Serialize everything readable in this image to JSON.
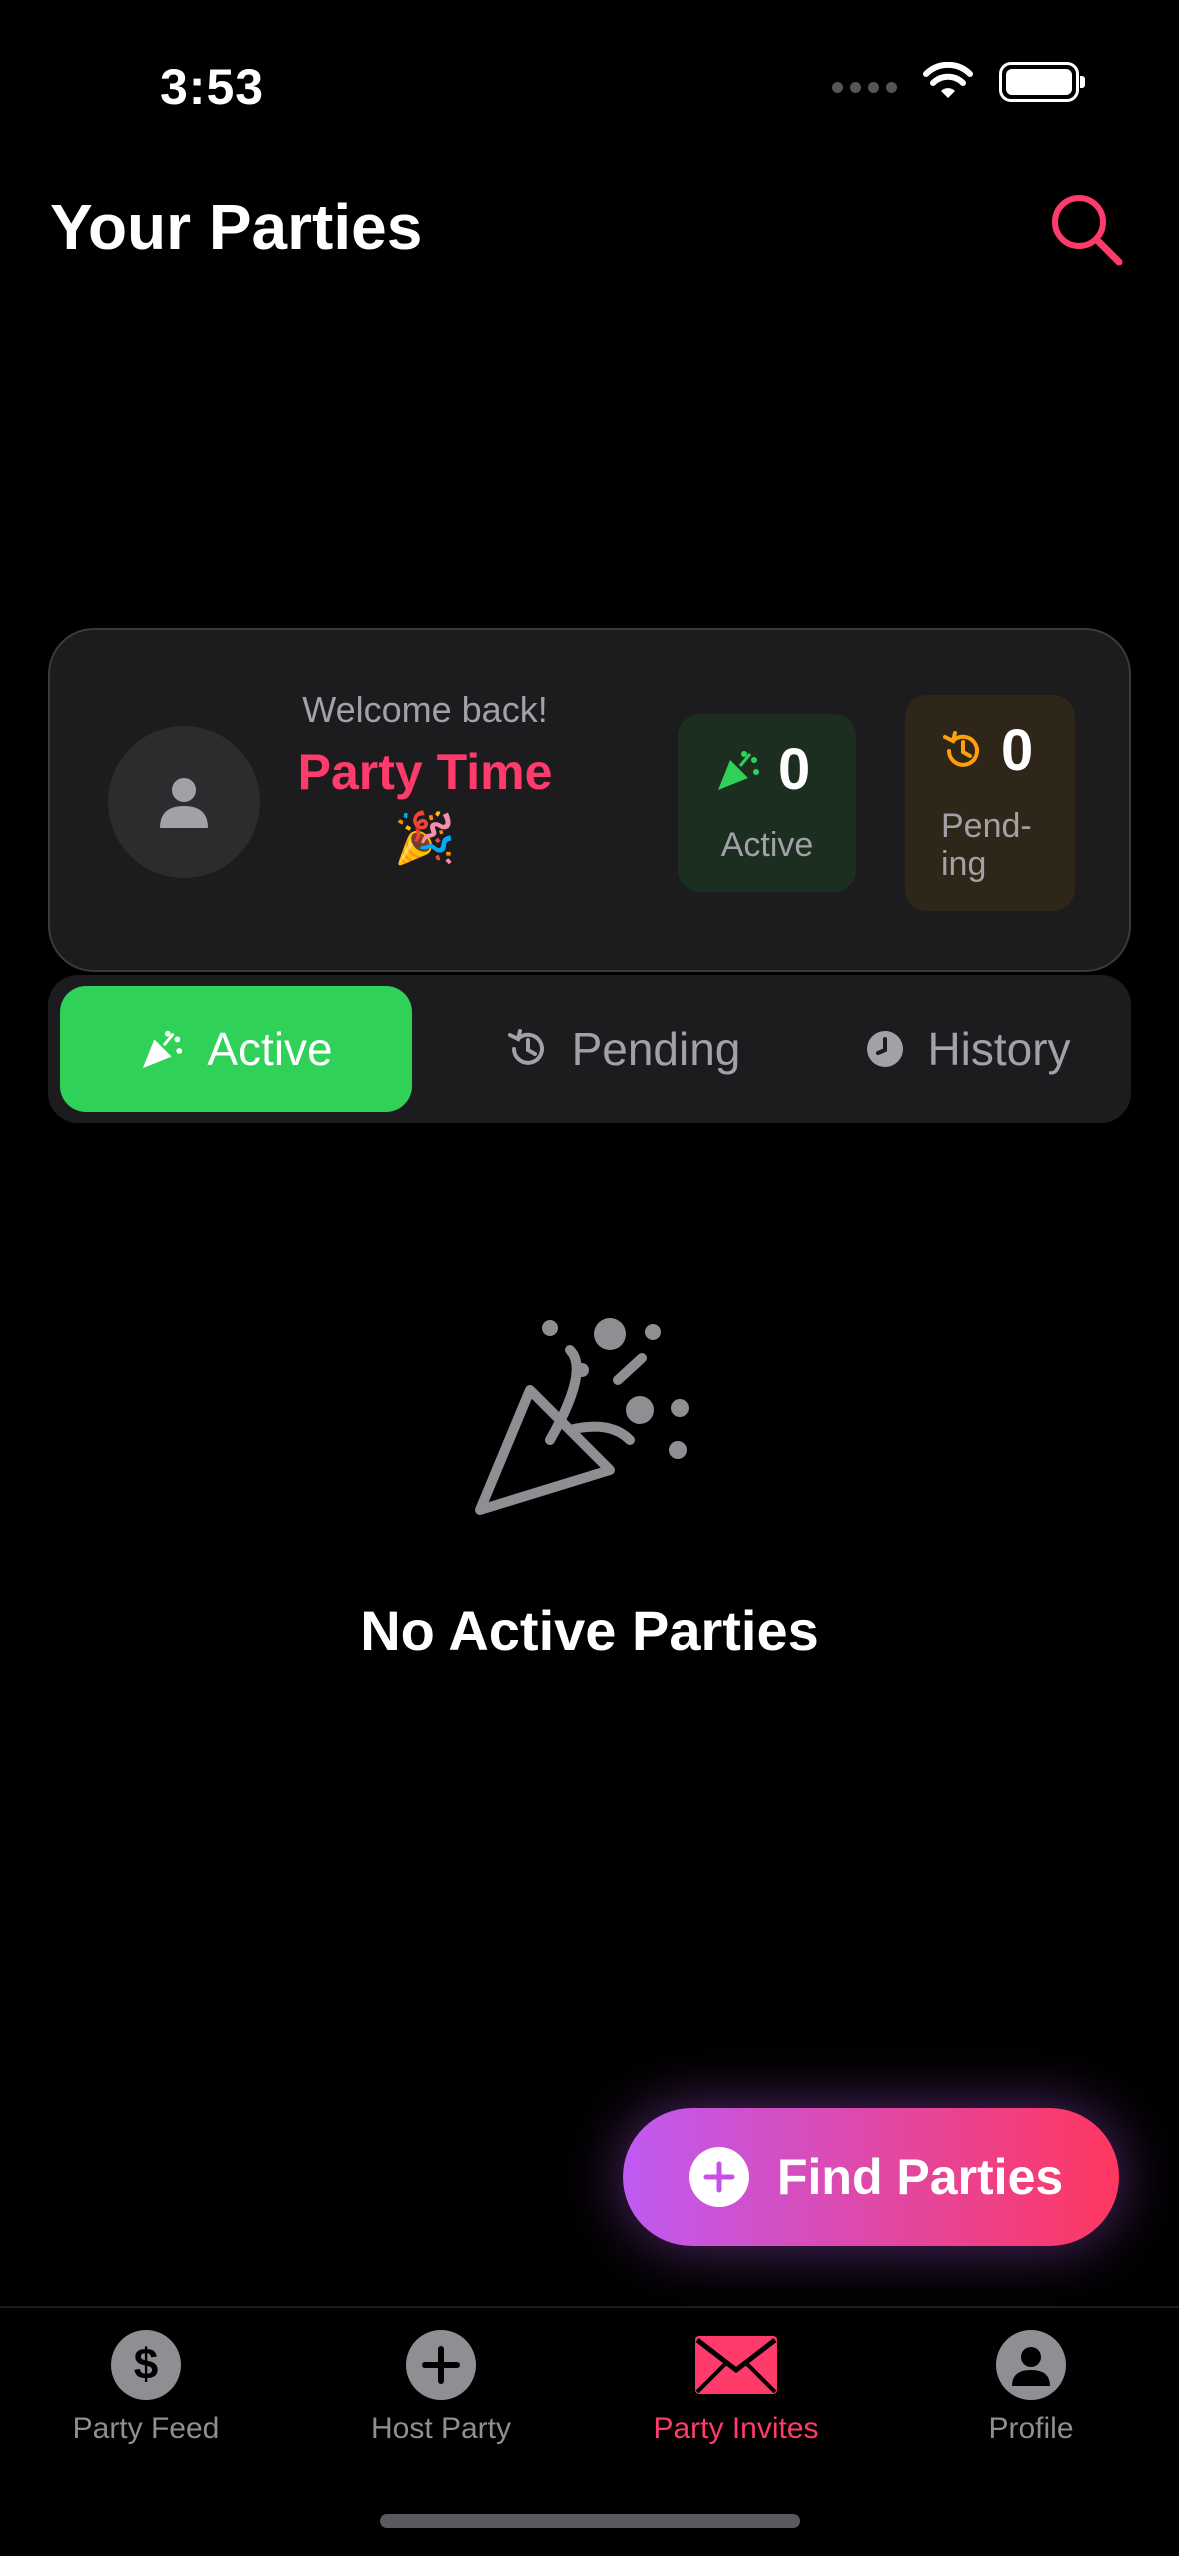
{
  "status_bar": {
    "time": "3:53"
  },
  "header": {
    "title": "Your Parties"
  },
  "summary": {
    "welcome": "Welcome back!",
    "name": "Party Time 🎉",
    "active_count": "0",
    "active_label": "Active",
    "pending_count": "0",
    "pending_label": "Pend-ing"
  },
  "tabs": [
    {
      "label": "Active"
    },
    {
      "label": "Pending"
    },
    {
      "label": "History"
    }
  ],
  "empty_state": {
    "title": "No Active Parties"
  },
  "fab": {
    "label": "Find Parties"
  },
  "bottom_nav": [
    {
      "label": "Party Feed",
      "icon": "dollar-icon"
    },
    {
      "label": "Host Party",
      "icon": "plus-icon"
    },
    {
      "label": "Party Invites",
      "icon": "envelope-icon"
    },
    {
      "label": "Profile",
      "icon": "person-icon"
    }
  ],
  "colors": {
    "accent": "#ff3b6b",
    "active_green": "#30d158",
    "pending_orange": "#ff9f0a"
  }
}
